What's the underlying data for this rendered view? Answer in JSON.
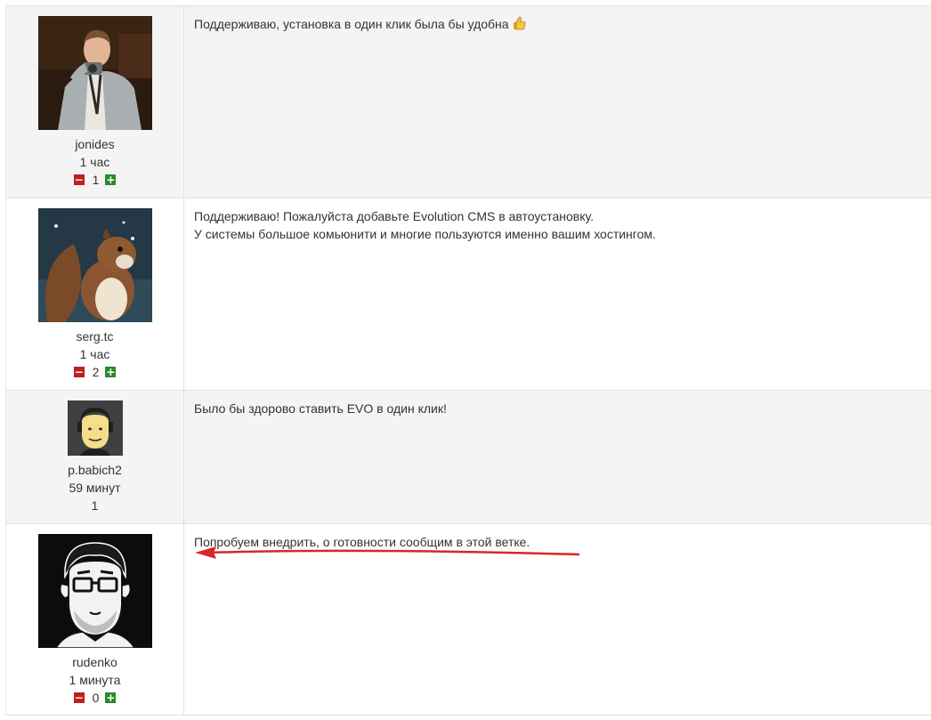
{
  "posts": [
    {
      "username": "jonides",
      "time": "1 час",
      "rating": "1",
      "text_lines": [
        "Поддерживаю, установка в один клик была бы удобна"
      ],
      "emoji": "thumbs-up-icon"
    },
    {
      "username": "serg.tc",
      "time": "1 час",
      "rating": "2",
      "text_lines": [
        "Поддерживаю! Пожалуйста добавьте Evolution CMS в автоустановку.",
        "У системы большое комьюнити и многие пользуются именно вашим хостингом."
      ]
    },
    {
      "username": "p.babich2",
      "time": "59 минут",
      "rating": "1",
      "text_lines": [
        "Было бы здорово ставить EVO в один клик!"
      ]
    },
    {
      "username": "rudenko",
      "time": "1 минута",
      "rating": "0",
      "text_lines": [
        "Попробуем внедрить, о готовности сообщим в этой ветке."
      ]
    }
  ],
  "colors": {
    "minus": "#c21d1d",
    "plus": "#2a8a2a",
    "arrow": "#d9262a",
    "row_grey": "#f4f4f4"
  }
}
